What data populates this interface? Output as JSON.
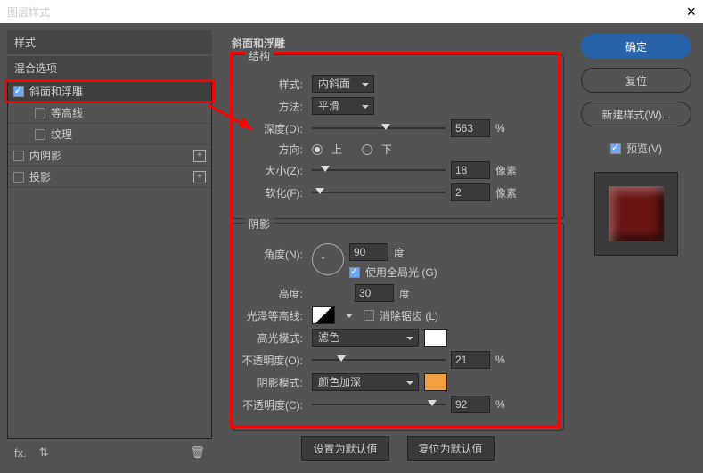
{
  "title": "图层样式",
  "left": {
    "hdr_style": "样式",
    "hdr_blend": "混合选项",
    "items": {
      "bevel": "斜面和浮雕",
      "contour": "等高线",
      "texture": "纹理",
      "innershadow": "内阴影",
      "dropshadow": "投影"
    },
    "foot": {
      "fx": "fx."
    }
  },
  "mid": {
    "section": "斜面和浮雕",
    "structure": {
      "title": "结构",
      "style_label": "样式:",
      "style_value": "内斜面",
      "method_label": "方法:",
      "method_value": "平滑",
      "depth_label": "深度(D):",
      "depth_value": "563",
      "depth_unit": "%",
      "direction_label": "方向:",
      "dir_up": "上",
      "dir_down": "下",
      "size_label": "大小(Z):",
      "size_value": "18",
      "px": "像素",
      "soften_label": "软化(F):",
      "soften_value": "2"
    },
    "shading": {
      "title": "阴影",
      "angle_label": "角度(N):",
      "angle_value": "90",
      "degree": "度",
      "globallight": "使用全局光 (G)",
      "altitude_label": "高度:",
      "altitude_value": "30",
      "gloss_label": "光泽等高线:",
      "antialias": "消除锯齿 (L)",
      "hl_mode_label": "高光模式:",
      "hl_mode_value": "滤色",
      "hl_opacity_label": "不透明度(O):",
      "hl_opacity_value": "21",
      "pct": "%",
      "sh_mode_label": "阴影模式:",
      "sh_mode_value": "颜色加深",
      "sh_opacity_label": "不透明度(C):",
      "sh_opacity_value": "92"
    },
    "buttons": {
      "default": "设置为默认值",
      "reset": "复位为默认值"
    }
  },
  "right": {
    "ok": "确定",
    "cancel": "复位",
    "newstyle": "新建样式(W)...",
    "preview": "预览(V)"
  }
}
